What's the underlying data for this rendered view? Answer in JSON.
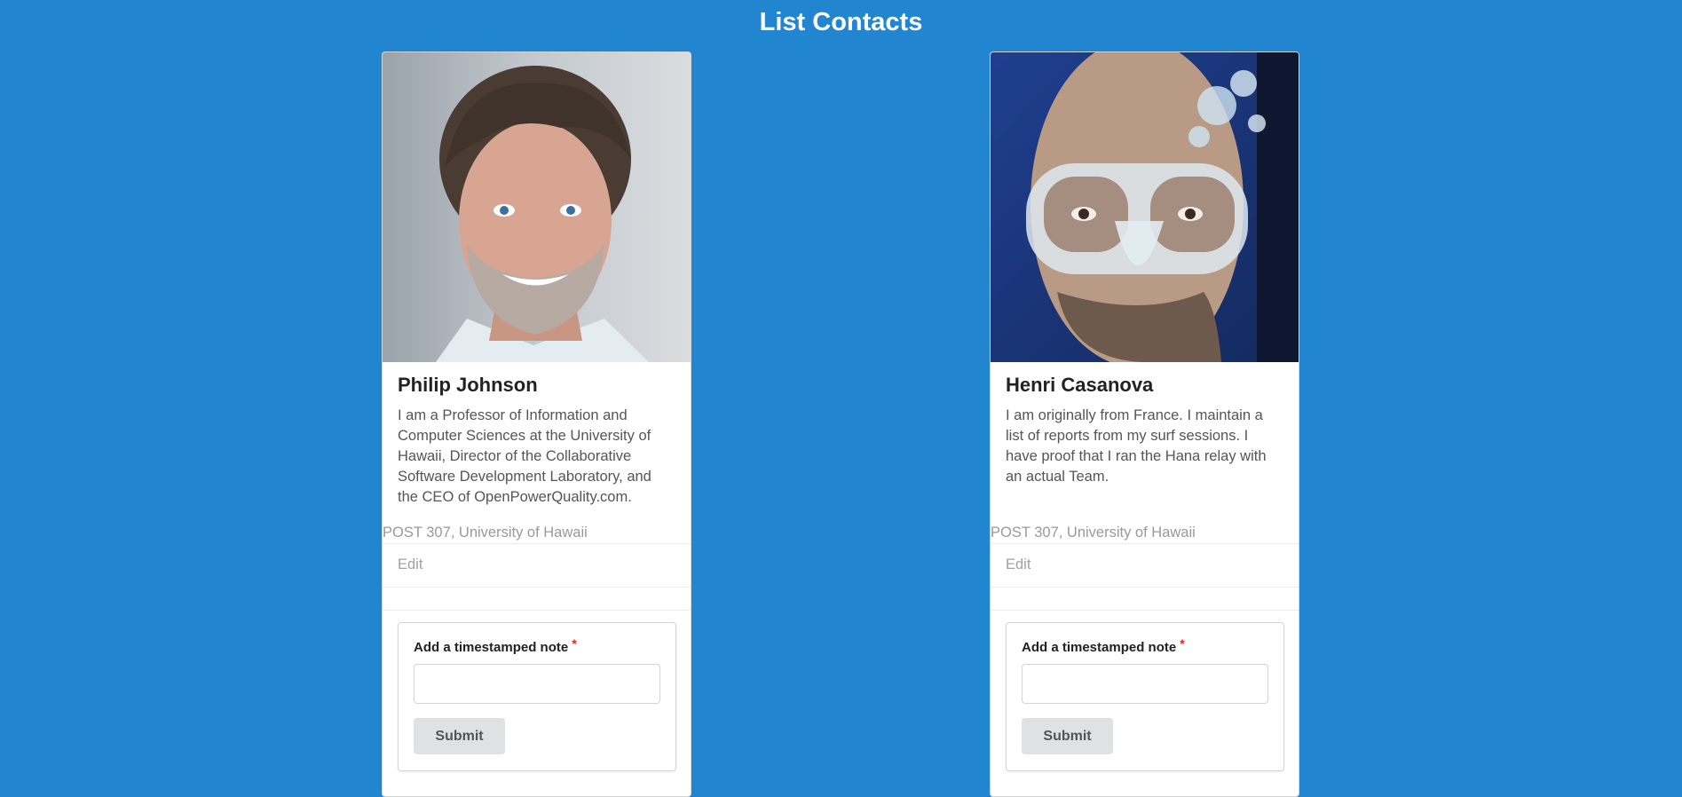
{
  "page": {
    "title": "List Contacts",
    "background_color": "#2185d0"
  },
  "contacts": [
    {
      "name": "Philip Johnson",
      "description": "I am a Professor of Information and Computer Sciences at the University of Hawaii, Director of the Collaborative Software Development Laboratory, and the CEO of OpenPowerQuality.com.",
      "address": "POST 307, University of Hawaii",
      "edit_label": "Edit",
      "note_label": "Add a timestamped note",
      "required_marker": "*",
      "note_value": "",
      "submit_label": "Submit"
    },
    {
      "name": "Henri Casanova",
      "description": "I am originally from France. I maintain a list of reports from my surf sessions. I have proof that I ran the Hana relay with an actual Team.",
      "address": "POST 307, University of Hawaii",
      "edit_label": "Edit",
      "note_label": "Add a timestamped note",
      "required_marker": "*",
      "note_value": "",
      "submit_label": "Submit"
    }
  ]
}
